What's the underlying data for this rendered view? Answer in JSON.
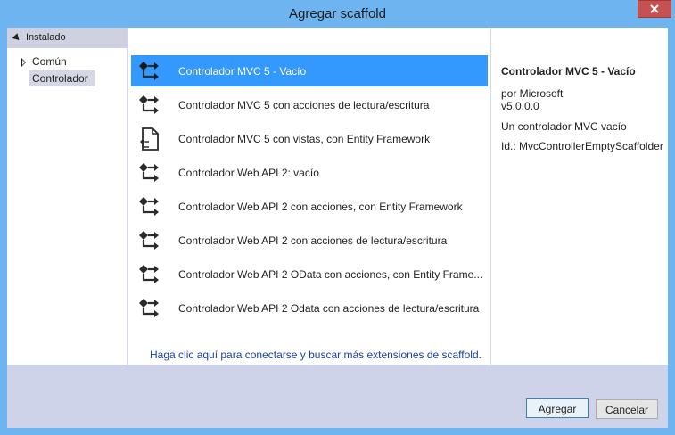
{
  "window": {
    "title": "Agregar scaffold",
    "close_icon": "close-icon"
  },
  "tree": {
    "header": "Instalado",
    "items": [
      {
        "label": "Común",
        "expandable": true,
        "selected": false
      },
      {
        "label": "Controlador",
        "expandable": false,
        "selected": true
      }
    ]
  },
  "scaffolds": [
    {
      "label": "Controlador MVC 5 - Vacío",
      "icon": "controller-icon",
      "selected": true
    },
    {
      "label": "Controlador MVC 5 con acciones de lectura/escritura",
      "icon": "controller-icon",
      "selected": false
    },
    {
      "label": "Controlador MVC 5 con vistas, con Entity Framework",
      "icon": "document-controller-icon",
      "selected": false
    },
    {
      "label": "Controlador Web API 2: vacío",
      "icon": "controller-icon",
      "selected": false
    },
    {
      "label": "Controlador Web API 2 con acciones, con Entity Framework",
      "icon": "controller-icon",
      "selected": false
    },
    {
      "label": "Controlador Web API 2 con acciones de lectura/escritura",
      "icon": "controller-icon",
      "selected": false
    },
    {
      "label": "Controlador Web API 2 OData con acciones, con Entity Frame...",
      "icon": "controller-icon",
      "selected": false
    },
    {
      "label": "Controlador Web API 2 Odata con acciones de lectura/escritura",
      "icon": "controller-icon",
      "selected": false
    }
  ],
  "online_link": "Haga clic aquí para conectarse y buscar más extensiones de scaffold.",
  "details": {
    "title": "Controlador MVC 5 - Vacío",
    "author": "por Microsoft",
    "version": "v5.0.0.0",
    "description": "Un controlador MVC vacío",
    "id": "Id.: MvcControllerEmptyScaffolder"
  },
  "buttons": {
    "add": "Agregar",
    "cancel": "Cancelar"
  },
  "colors": {
    "window_frame": "#6eb4f0",
    "selection": "#3399ff",
    "close_button": "#c75050",
    "link": "#1a3fa8"
  }
}
